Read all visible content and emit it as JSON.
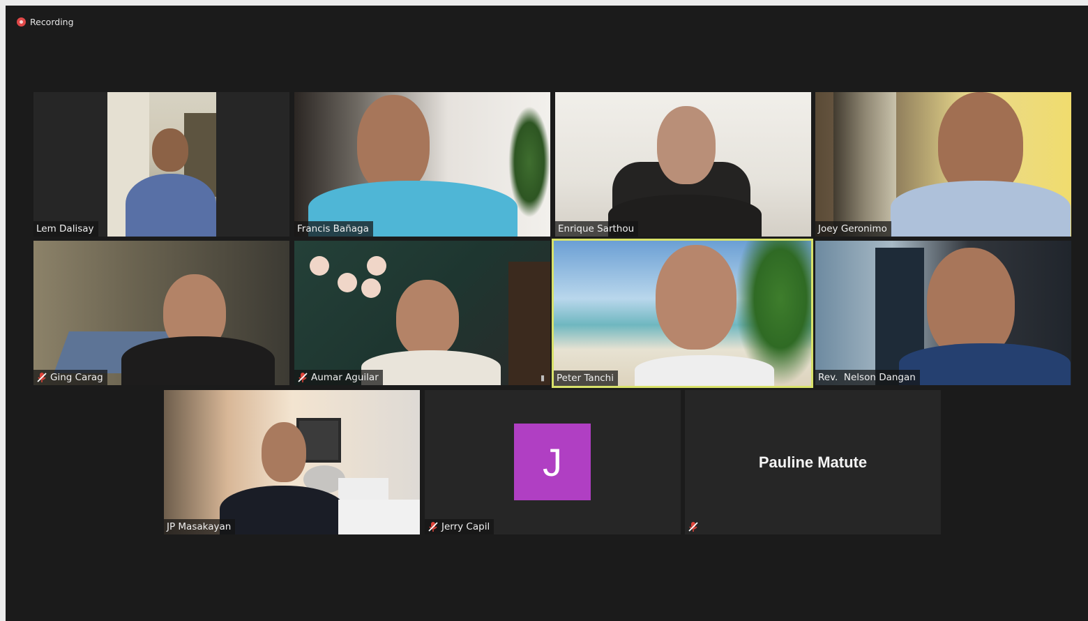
{
  "recording": {
    "label": "Recording",
    "icon": "record-icon",
    "color": "#e04848"
  },
  "gallery": {
    "participants": [
      {
        "name": "Lem Dalisay",
        "muted": false,
        "video": true
      },
      {
        "name": "Francis Bañaga",
        "muted": false,
        "video": true
      },
      {
        "name": "Enrique Sarthou",
        "muted": false,
        "video": true
      },
      {
        "name": "Joey Geronimo",
        "muted": false,
        "video": true
      },
      {
        "name": "Ging Carag",
        "muted": true,
        "video": true
      },
      {
        "name": "Aumar Aguilar",
        "muted": true,
        "video": true
      },
      {
        "name": "Peter Tanchi",
        "muted": false,
        "video": true,
        "active_speaker": true
      },
      {
        "name": "Rev.  Nelson Dangan",
        "muted": false,
        "video": true
      },
      {
        "name": "JP Masakayan",
        "muted": false,
        "video": true
      },
      {
        "name": "Jerry Capil",
        "muted": true,
        "video": false,
        "avatar_letter": "J"
      },
      {
        "name": "Pauline Matute",
        "muted": true,
        "video": false
      }
    ]
  },
  "colors": {
    "background": "#1b1b1b",
    "tile": "#262626",
    "active_border": "#d8e26a",
    "avatar": "#b03fc3",
    "muted_icon": "#e0443a"
  }
}
